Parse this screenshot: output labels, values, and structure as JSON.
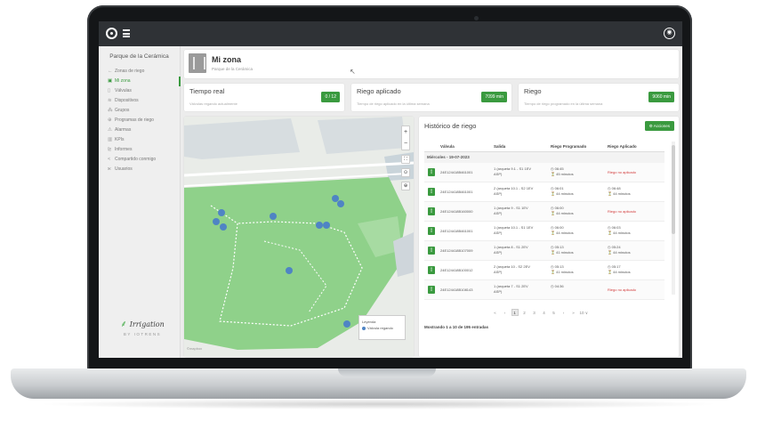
{
  "sidebar": {
    "park_name": "Parque de la Cerámica",
    "items": [
      {
        "label": "Zonas de riego",
        "icon": "arrow-left-icon",
        "glyph": "←"
      },
      {
        "label": "Mi zona",
        "icon": "zone-icon",
        "glyph": "▣"
      },
      {
        "label": "Válvulas",
        "icon": "valve-icon",
        "glyph": "▯"
      },
      {
        "label": "Dispositivos",
        "icon": "wifi-icon",
        "glyph": "≋"
      },
      {
        "label": "Grupos",
        "icon": "group-icon",
        "glyph": "⁂"
      },
      {
        "label": "Programas de riego",
        "icon": "program-icon",
        "glyph": "⊕"
      },
      {
        "label": "Alarmas",
        "icon": "alarm-icon",
        "glyph": "⚠"
      },
      {
        "label": "KPIs",
        "icon": "kpi-icon",
        "glyph": "▥"
      },
      {
        "label": "Informes",
        "icon": "report-icon",
        "glyph": "⊵"
      },
      {
        "label": "Compartido conmigo",
        "icon": "share-icon",
        "glyph": "<"
      },
      {
        "label": "Usuarios",
        "icon": "users-icon",
        "glyph": "ж"
      }
    ],
    "brand_name": "Irrigation",
    "brand_sub": "BY IOTRENS"
  },
  "zone": {
    "title": "Mi zona",
    "subtitle": "Parque de la Cerámica"
  },
  "stats": [
    {
      "title": "Tiempo real",
      "subtitle": "Válvulas regando actualmente",
      "value": "0 / 12"
    },
    {
      "title": "Riego aplicado",
      "subtitle": "Tiempo de riego aplicado en la última semana",
      "value": "7099 min"
    },
    {
      "title": "Riego",
      "subtitle": "Tiempo de riego programado en la última semana",
      "value": "9060 min"
    }
  ],
  "map": {
    "zoom_in": "+",
    "zoom_out": "−",
    "fullscreen": "⛶",
    "locate": "⊙",
    "layers": "⊕",
    "legend_title": "Leyenda",
    "legend_item": "Válvula regando",
    "credit": "©mapbox"
  },
  "history": {
    "title": "Histórico de riego",
    "actions_label": "⚙ Acciones",
    "columns": [
      "Válvula",
      "Salida",
      "Riego Programado",
      "Riego Aplicado"
    ],
    "group_label": "Miércoles - 19-07-2023",
    "rows": [
      {
        "valve": "24E124418B461001",
        "out1": "1 (arqueta 9.1 - S1 1EV",
        "out2": "ASP)",
        "prog1": "◷ 06:45",
        "prog2": "⏳ 45 minutos",
        "app1": "Riego no aplicado",
        "app2": "",
        "not_applied": true
      },
      {
        "valve": "24E124418B461001",
        "out1": "2 (arqueta 10.1 - S2 1EV",
        "out2": "ASP)",
        "prog1": "◷ 06:01",
        "prog2": "⏳ 44 minutos",
        "app1": "◷ 06:48",
        "app2": "⏳ 44 minutos",
        "not_applied": false
      },
      {
        "valve": "24E124418B160000",
        "out1": "1 (arqueta 9 - S1 1EV",
        "out2": "ASP)",
        "prog1": "◷ 06:00",
        "prog2": "⏳ 44 minutos",
        "app1": "Riego no aplicado",
        "app2": "",
        "not_applied": true
      },
      {
        "valve": "24E124418B461001",
        "out1": "1 (arqueta 10.1 - S1 1EV",
        "out2": "ASP)",
        "prog1": "◷ 06:00",
        "prog2": "⏳ 44 minutos",
        "app1": "◷ 06:03",
        "app2": "⏳ 44 minutos",
        "not_applied": false
      },
      {
        "valve": "24E124418B107009",
        "out1": "1 (arqueta 8 - S1 2EV",
        "out2": "ASP)",
        "prog1": "◷ 05:13",
        "prog2": "⏳ 41 minutos",
        "app1": "◷ 05:24",
        "app2": "⏳ 44 minutos",
        "not_applied": false
      },
      {
        "valve": "24E124418B100012",
        "out1": "2 (arqueta 10 - S2 2EV",
        "out2": "ASP)",
        "prog1": "◷ 05:13",
        "prog2": "⏳ 41 minutos",
        "app1": "◷ 05:17",
        "app2": "⏳ 44 minutos",
        "not_applied": false
      },
      {
        "valve": "24E124418B108143",
        "out1": "1 (arqueta 7 - S1 2EV",
        "out2": "ASP)",
        "prog1": "◷ 04:36",
        "prog2": "",
        "app1": "Riego no aplicado",
        "app2": "",
        "not_applied": true
      }
    ],
    "pager": [
      "«",
      "‹",
      "1",
      "2",
      "3",
      "4",
      "5",
      "›",
      "»",
      "10 ∨"
    ],
    "pager_current": "1",
    "showing": "Mostrando 1 a 10 de 195 entradas"
  },
  "colors": {
    "accent": "#3a9a3f",
    "topbar": "#2f3236",
    "danger": "#d23b3b",
    "park": "#8fd18a",
    "pin": "#4f84c4"
  }
}
